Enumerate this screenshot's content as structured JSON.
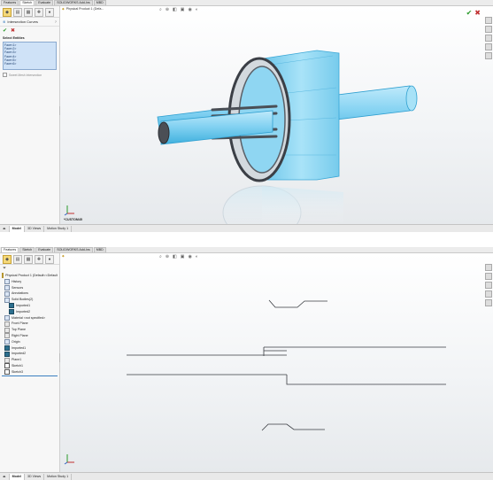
{
  "top": {
    "tabs": [
      "Features",
      "Sketch",
      "Evaluate",
      "SOLIDWORKS Add-Ins",
      "MBD"
    ],
    "active_tab": "Sketch",
    "property_manager": {
      "title": "Intersection Curves",
      "ok_icon": "check-icon",
      "cancel_icon": "close-icon",
      "group_label": "Select Entities",
      "entities": [
        "Face<1>",
        "Face<2>",
        "Face<3>",
        "Face<4>",
        "Face<5>",
        "Face<6>"
      ],
      "option_label": "Sweet Mesh Intersection"
    },
    "breadcrumb": "Physical Product 1 (Defa...",
    "view_label": "*CUSTOM45",
    "status_tabs": [
      "Model",
      "3D Views",
      "Motion Study 1"
    ],
    "colors": {
      "body_fill": "#8fd6f2",
      "body_stroke": "#3aa7d6",
      "dark_ring": "#3b3f46"
    }
  },
  "bottom": {
    "tabs": [
      "Features",
      "Sketch",
      "Evaluate",
      "SOLIDWORKS Add-Ins",
      "MBD"
    ],
    "active_tab": "Features",
    "tree": [
      {
        "label": "Physical Product 1 (Default<<Default",
        "icon": "part-icon"
      },
      {
        "label": "History",
        "icon": "history-icon"
      },
      {
        "label": "Sensors",
        "icon": "sensor-icon"
      },
      {
        "label": "Annotations",
        "icon": "annotations-icon"
      },
      {
        "label": "Solid Bodies(2)",
        "icon": "solid-bodies-icon"
      },
      {
        "label": "Imported1",
        "icon": "body-icon"
      },
      {
        "label": "Imported2",
        "icon": "body-icon"
      },
      {
        "label": "Material <not specified>",
        "icon": "material-icon"
      },
      {
        "label": "Front Plane",
        "icon": "plane-icon"
      },
      {
        "label": "Top Plane",
        "icon": "plane-icon"
      },
      {
        "label": "Right Plane",
        "icon": "plane-icon"
      },
      {
        "label": "Origin",
        "icon": "origin-icon"
      },
      {
        "label": "Imported1",
        "icon": "body-icon"
      },
      {
        "label": "Imported2",
        "icon": "body-icon"
      },
      {
        "label": "Plane1",
        "icon": "plane-icon"
      },
      {
        "label": "Sketch1",
        "icon": "sketch-icon"
      },
      {
        "label": "Sketch3",
        "icon": "sketch-icon"
      }
    ],
    "status_tabs": [
      "Model",
      "3D Views",
      "Motion Study 1"
    ]
  }
}
